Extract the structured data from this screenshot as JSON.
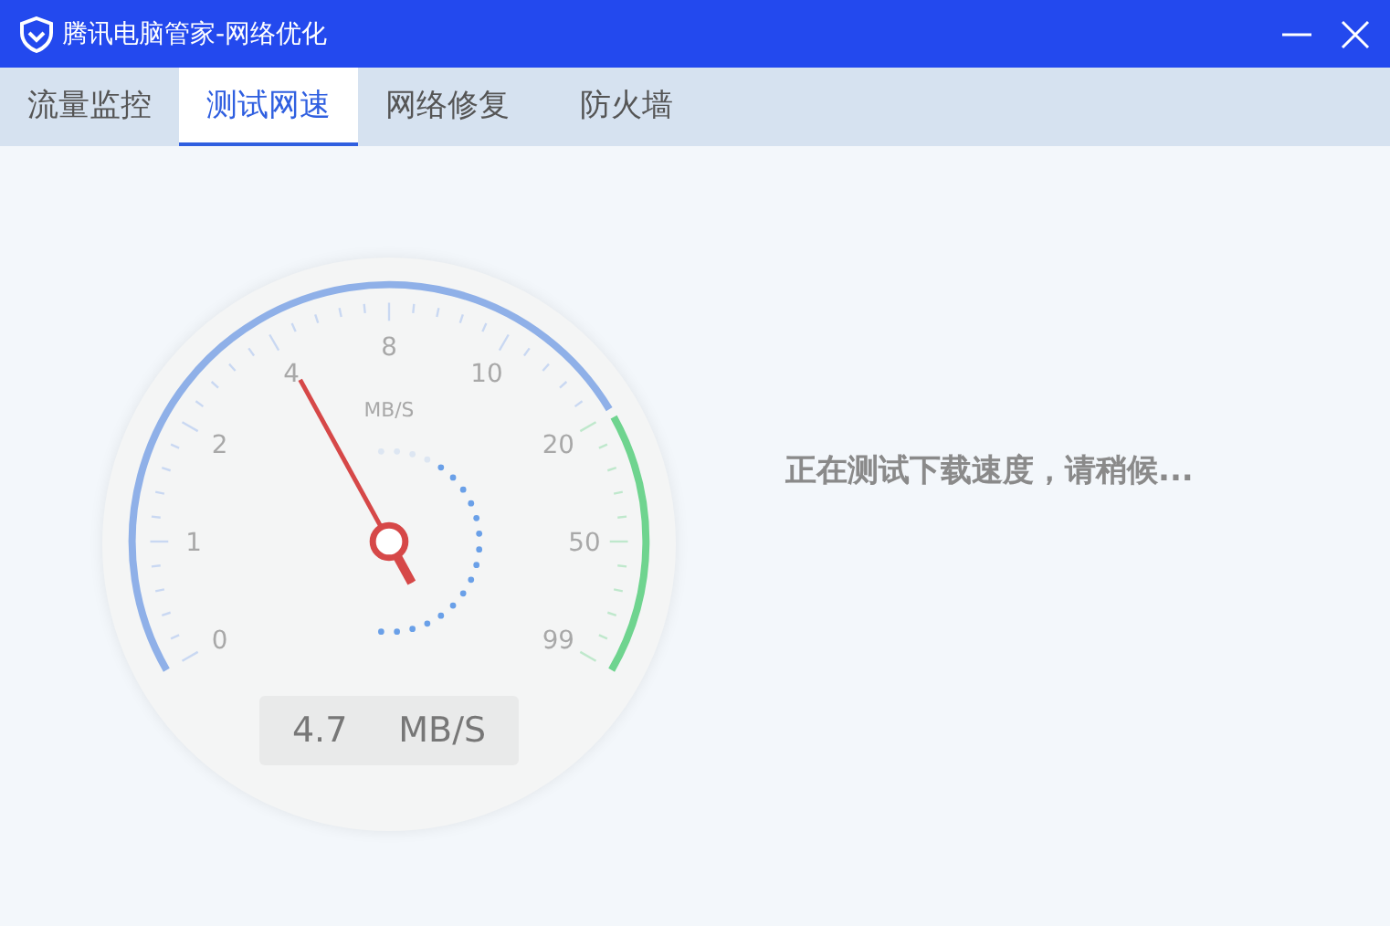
{
  "window": {
    "title": "腾讯电脑管家-网络优化",
    "controls": [
      {
        "kind": "minimize"
      },
      {
        "kind": "close"
      }
    ]
  },
  "tabs": [
    {
      "label": "流量监控",
      "selected": false
    },
    {
      "label": "测试网速",
      "selected": true
    },
    {
      "label": "网络修复",
      "selected": false
    },
    {
      "label": "防火墙",
      "selected": false
    }
  ],
  "gauge": {
    "unit": "MB/S",
    "scale_labels": [
      "0",
      "1",
      "2",
      "4",
      "8",
      "10",
      "20",
      "50",
      "99"
    ],
    "level": 0.38,
    "reading": "4.7",
    "reading_unit": "MB/S"
  },
  "status": "正在测试下载速度，请稍候..."
}
